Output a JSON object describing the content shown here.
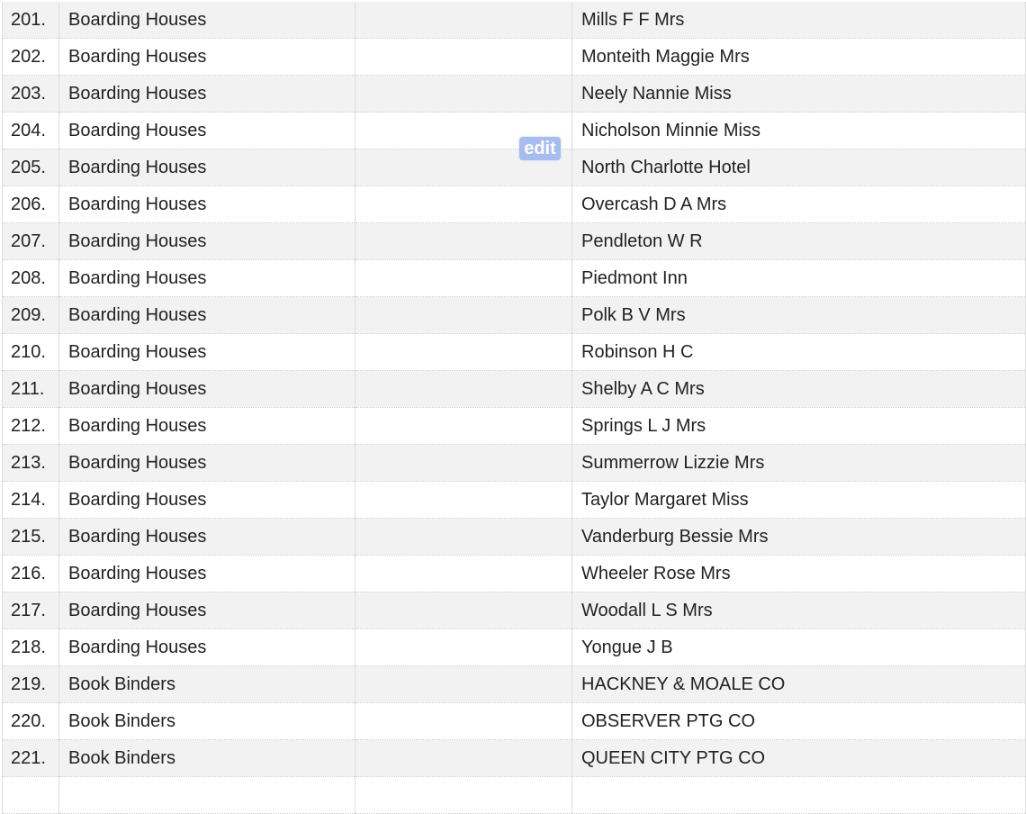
{
  "edit_label": "edit",
  "rows": [
    {
      "num": "201.",
      "category": "Boarding Houses",
      "extra": "",
      "name": "Mills F F Mrs"
    },
    {
      "num": "202.",
      "category": "Boarding Houses",
      "extra": "",
      "name": "Monteith Maggie Mrs"
    },
    {
      "num": "203.",
      "category": "Boarding Houses",
      "extra": "",
      "name": "Neely Nannie Miss"
    },
    {
      "num": "204.",
      "category": "Boarding Houses",
      "extra": "",
      "name": "Nicholson Minnie Miss"
    },
    {
      "num": "205.",
      "category": "Boarding Houses",
      "extra": "",
      "name": "North Charlotte Hotel"
    },
    {
      "num": "206.",
      "category": "Boarding Houses",
      "extra": "",
      "name": "Overcash D A Mrs"
    },
    {
      "num": "207.",
      "category": "Boarding Houses",
      "extra": "",
      "name": "Pendleton W R"
    },
    {
      "num": "208.",
      "category": "Boarding Houses",
      "extra": "",
      "name": "Piedmont Inn"
    },
    {
      "num": "209.",
      "category": "Boarding Houses",
      "extra": "",
      "name": "Polk B V Mrs"
    },
    {
      "num": "210.",
      "category": "Boarding Houses",
      "extra": "",
      "name": "Robinson H C"
    },
    {
      "num": "211.",
      "category": "Boarding Houses",
      "extra": "",
      "name": "Shelby A C Mrs"
    },
    {
      "num": "212.",
      "category": "Boarding Houses",
      "extra": "",
      "name": "Springs L J Mrs"
    },
    {
      "num": "213.",
      "category": "Boarding Houses",
      "extra": "",
      "name": "Summerrow Lizzie Mrs"
    },
    {
      "num": "214.",
      "category": "Boarding Houses",
      "extra": "",
      "name": "Taylor Margaret Miss"
    },
    {
      "num": "215.",
      "category": "Boarding Houses",
      "extra": "",
      "name": "Vanderburg Bessie Mrs"
    },
    {
      "num": "216.",
      "category": "Boarding Houses",
      "extra": "",
      "name": "Wheeler Rose Mrs"
    },
    {
      "num": "217.",
      "category": "Boarding Houses",
      "extra": "",
      "name": "Woodall L S Mrs"
    },
    {
      "num": "218.",
      "category": "Boarding Houses",
      "extra": "",
      "name": "Yongue J B"
    },
    {
      "num": "219.",
      "category": "Book Binders",
      "extra": "",
      "name": "HACKNEY & MOALE CO"
    },
    {
      "num": "220.",
      "category": "Book Binders",
      "extra": "",
      "name": "OBSERVER PTG CO"
    },
    {
      "num": "221.",
      "category": "Book Binders",
      "extra": "",
      "name": "QUEEN CITY PTG CO"
    },
    {
      "num": "",
      "category": "",
      "extra": "",
      "name": ""
    }
  ]
}
